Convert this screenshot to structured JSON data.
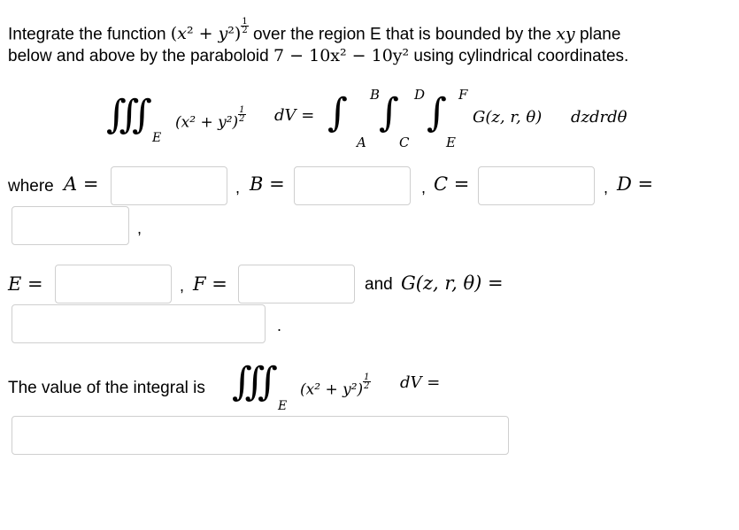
{
  "problem": {
    "line1_a": "Integrate the function",
    "line1_b": "over the region E that is bounded by the",
    "line1_var": "xy",
    "line1_c": "plane",
    "line2_a": "below and above by the paraboloid",
    "line2_b": "using cylindrical coordinates.",
    "func_x": "x",
    "func_y": "y",
    "exp_num": "1",
    "exp_den": "2",
    "paraboloid": "7 − 10x² − 10y²"
  },
  "equation": {
    "left": "∭",
    "region": "E",
    "integrand": "(x² + y²)",
    "dv": "dV =",
    "limits": [
      {
        "upper": "B",
        "lower": "A"
      },
      {
        "upper": "D",
        "lower": "C"
      },
      {
        "upper": "F",
        "lower": "E"
      }
    ],
    "integral_sign": "∫",
    "rhs": "G(z, r, θ)",
    "differentials": "dzdrdθ"
  },
  "answers": {
    "where_label": "where",
    "A_label": "A =",
    "B_label": "B =",
    "C_label": "C =",
    "D_label": "D =",
    "E_label": "E =",
    "F_label": "F =",
    "G_text": "and",
    "G_label": "G(z, r, θ) =",
    "comma": ",",
    "period": ".",
    "final_text": "The value of the integral is",
    "final_dv": "dV ="
  },
  "inputs": {
    "A": "",
    "B": "",
    "C": "",
    "D": "",
    "E": "",
    "F": "",
    "G": "",
    "value": ""
  }
}
